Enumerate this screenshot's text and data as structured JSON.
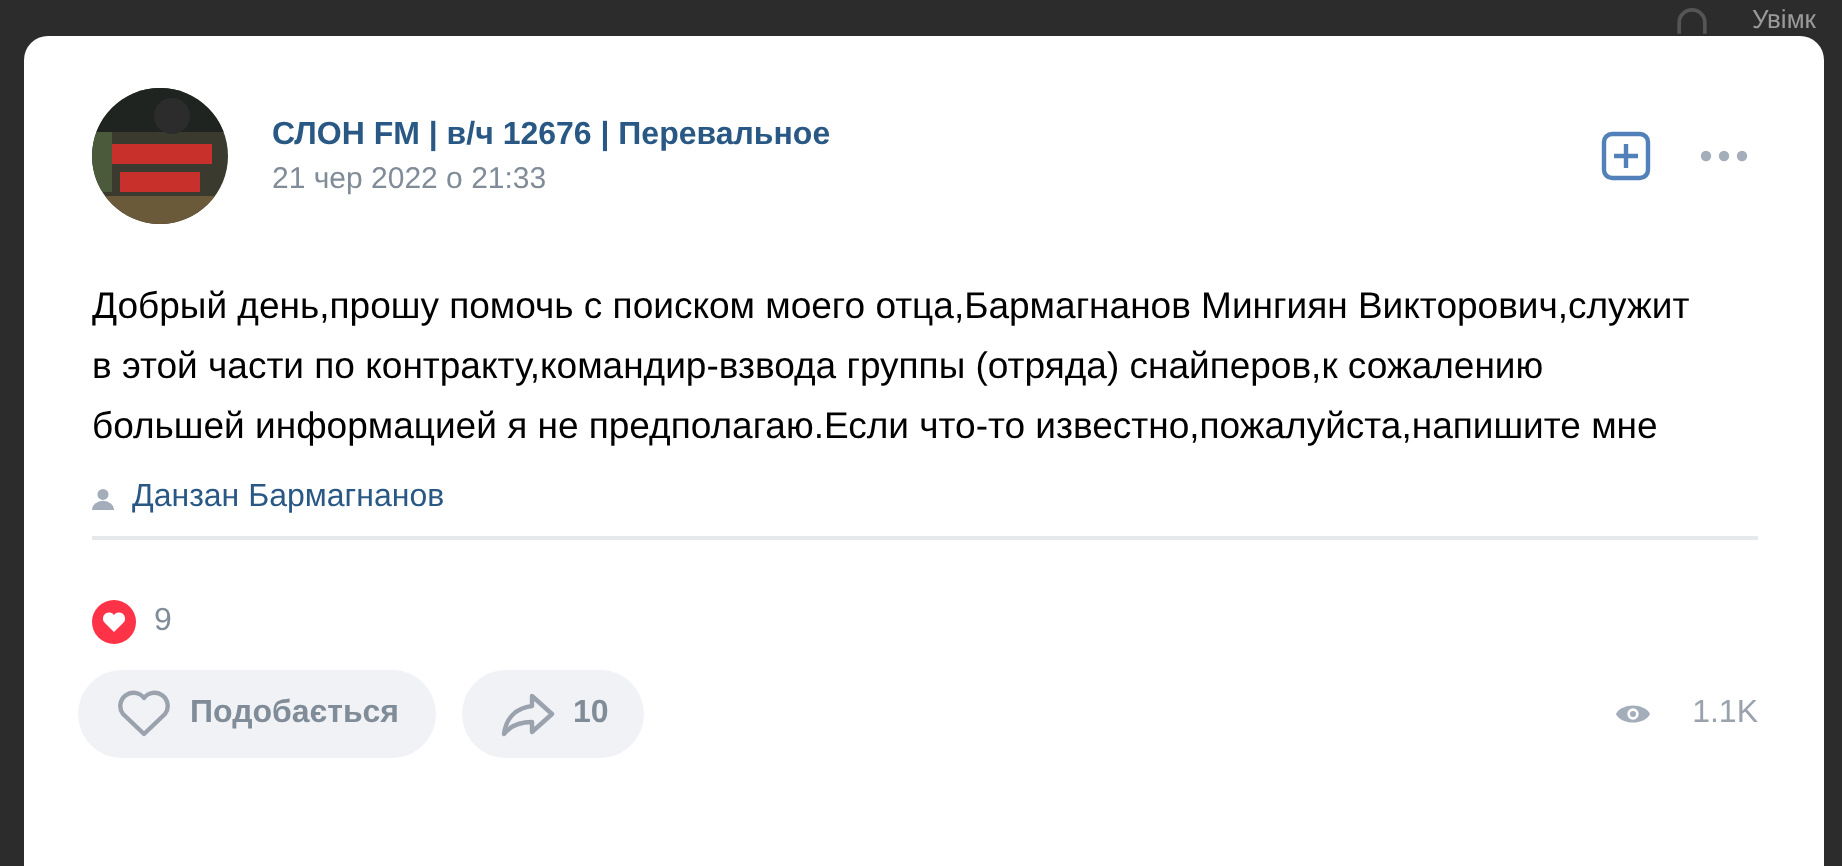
{
  "background": {
    "notification_label": "Увімк"
  },
  "post": {
    "author": "СЛОН FM | в/ч 12676 | Перевальное",
    "date": "21 чер 2022 о 21:33",
    "text": "Добрый день,прошу помочь с поиском моего отца,Бармагнанов Мингиян Викторович,служит в этой части по контракту,командир-взвода группы (отряда) снайперов,к сожалению большей информацией я не предполагаю.Если что-то известно,пожалуйста,напишите мне",
    "signer": "Данзан Бармагнанов",
    "reactions_count": "9",
    "actions": [
      {
        "kind": "like",
        "label": "Подобається"
      },
      {
        "kind": "share",
        "label": "10"
      }
    ],
    "views": "1.1K"
  }
}
